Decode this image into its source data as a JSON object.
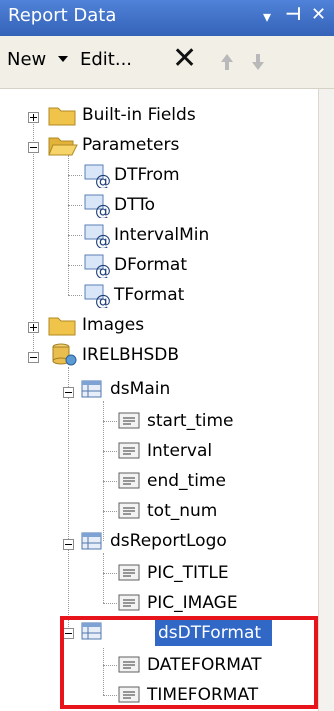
{
  "window": {
    "title": "Report Data",
    "pin_glyph": "▾",
    "autohide_glyph": "⊣",
    "close_glyph": "✕"
  },
  "toolbar": {
    "new_label": "New",
    "edit_label": "Edit...",
    "delete_icon": "delete-x-icon",
    "move_up_icon": "arrow-up-icon",
    "move_down_icon": "arrow-down-icon"
  },
  "tree": {
    "builtin_fields": "Built-in Fields",
    "parameters": {
      "label": "Parameters",
      "items": [
        "DTFrom",
        "DTTo",
        "IntervalMin",
        "DFormat",
        "TFormat"
      ]
    },
    "images": "Images",
    "datasource": {
      "label": "IRELBHSDB",
      "datasets": [
        {
          "label": "dsMain",
          "fields": [
            "start_time",
            "Interval",
            "end_time",
            "tot_num"
          ]
        },
        {
          "label": "dsReportLogo",
          "fields": [
            "PIC_TITLE",
            "PIC_IMAGE"
          ]
        },
        {
          "label": "dsDTFormat",
          "fields": [
            "DATEFORMAT",
            "TIMEFORMAT"
          ]
        }
      ]
    }
  },
  "colors": {
    "titlebar": "#3d6fc7",
    "selection": "#3168c6",
    "annotation_box": "#e8141b",
    "folder": "#f0c44a"
  }
}
